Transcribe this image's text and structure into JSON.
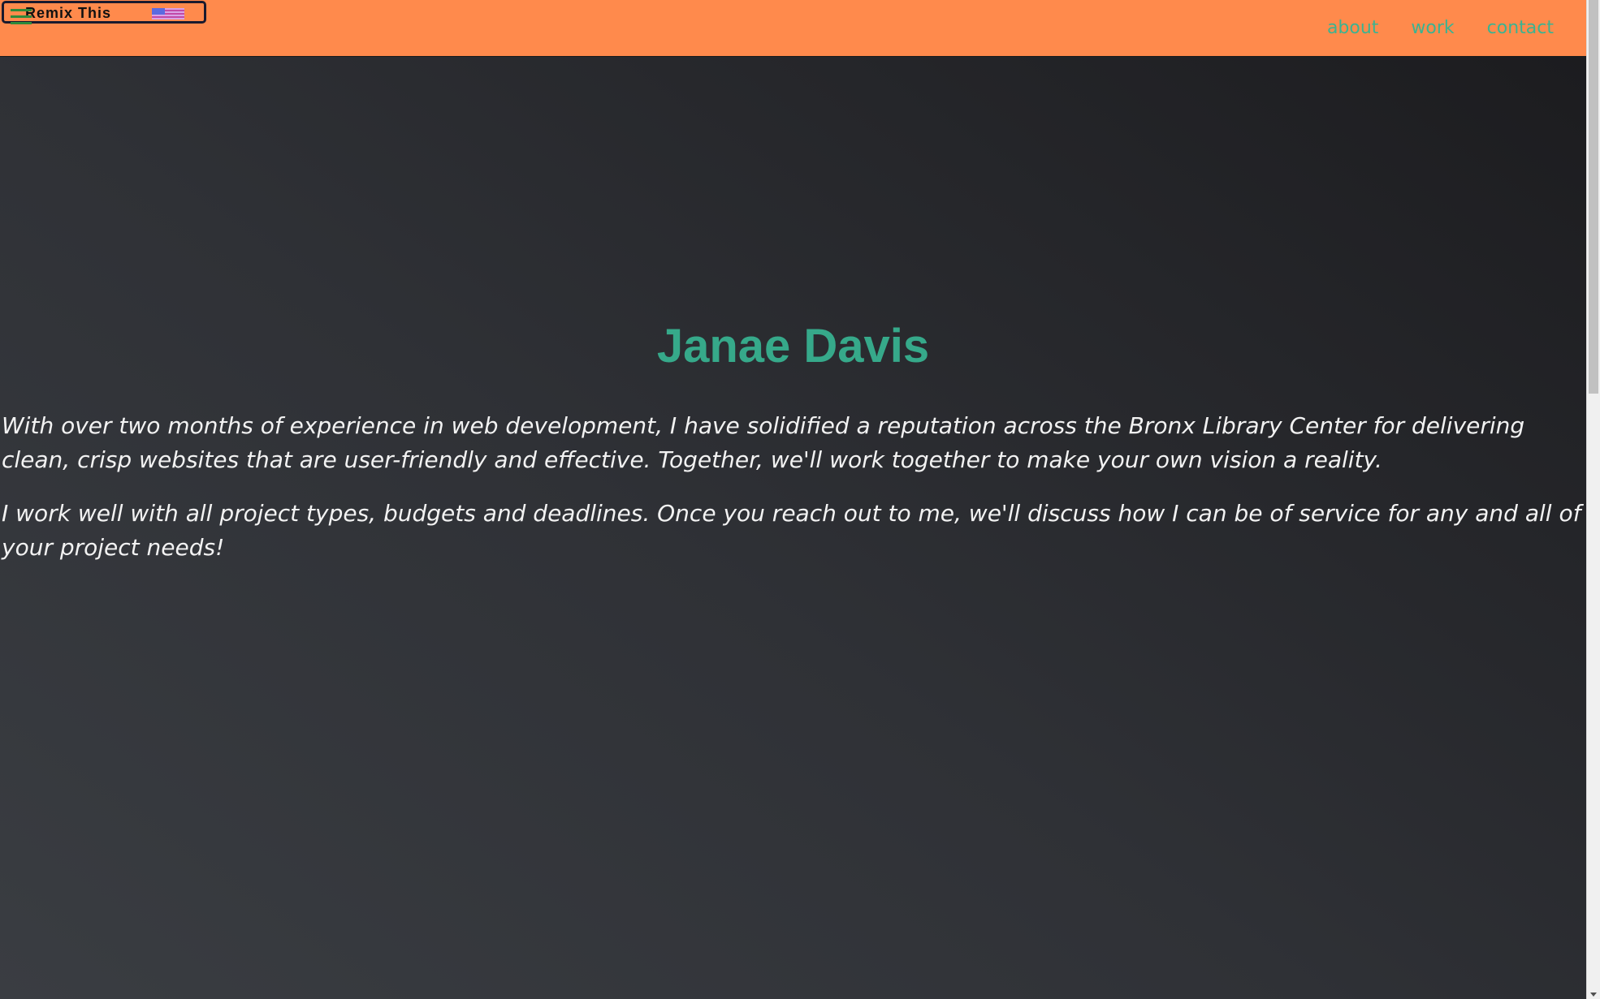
{
  "remix_badge": {
    "label": "Remix This",
    "flag_icon": "flag-icon"
  },
  "nav": {
    "links": [
      {
        "label": "about"
      },
      {
        "label": "work"
      },
      {
        "label": "contact"
      }
    ]
  },
  "hero": {
    "name": "Janae Davis",
    "paragraphs": [
      "With over two months of experience in web development, I have solidified a reputation across the Bronx Library Center for delivering clean, crisp websites that are user-friendly and effective. Together, we'll work together to make your own vision a reality.",
      "I work well with all project types, budgets and deadlines. Once you reach out to me, we'll discuss how I can be of service for any and all of your project needs!"
    ]
  },
  "colors": {
    "navbar": "#ff8a4c",
    "accent": "#36a98a",
    "background": "#2b2d30",
    "text": "#f2f2f2"
  }
}
